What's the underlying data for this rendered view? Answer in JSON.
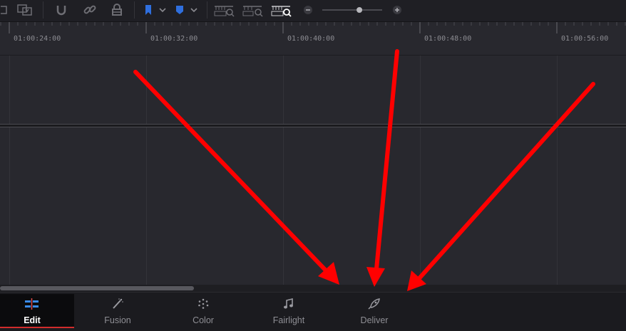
{
  "toolbar": {
    "icons": [
      "link-clips-icon",
      "replace-clip-icon",
      "snapping-icon",
      "linked-selection-icon",
      "lock-icon",
      "flag-icon",
      "marker-icon",
      "zoom-full-icon",
      "zoom-detail-icon",
      "zoom-custom-icon",
      "zoom-out-icon",
      "zoom-in-icon"
    ],
    "zoom_level": 0.62,
    "flag_color": "#2f6fde",
    "marker_color": "#2f6fde"
  },
  "ruler": {
    "timecodes": [
      "01:00:24:00",
      "01:00:32:00",
      "01:00:40:00",
      "01:00:48:00",
      "01:00:56:00"
    ]
  },
  "scrollbar": {
    "position": 0.0,
    "visible_fraction": 0.31
  },
  "pages": [
    {
      "label": "Edit",
      "icon": "edit-page-icon",
      "active": true
    },
    {
      "label": "Fusion",
      "icon": "fusion-page-icon",
      "active": false
    },
    {
      "label": "Color",
      "icon": "color-page-icon",
      "active": false
    },
    {
      "label": "Fairlight",
      "icon": "fairlight-page-icon",
      "active": false
    },
    {
      "label": "Deliver",
      "icon": "deliver-page-icon",
      "active": false
    }
  ],
  "annotation": {
    "arrow_color": "#ff0000"
  }
}
